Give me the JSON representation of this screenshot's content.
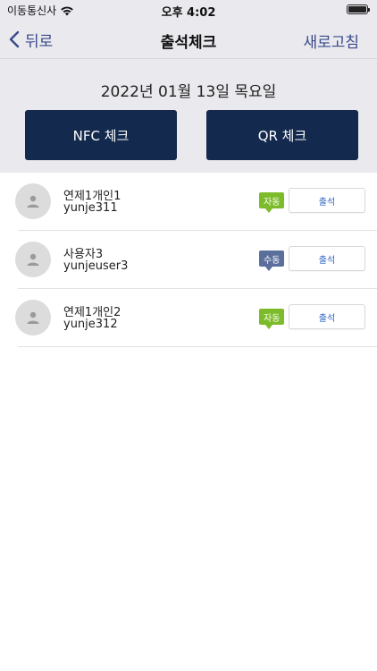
{
  "status_bar": {
    "carrier": "이동통신사",
    "time": "오후 4:02"
  },
  "nav": {
    "back_label": "뒤로",
    "title": "출석체크",
    "refresh_label": "새로고침"
  },
  "header": {
    "date": "2022년 01월 13일 목요일",
    "nfc_label": "NFC 체크",
    "qr_label": "QR 체크"
  },
  "users": [
    {
      "name": "연제1개인1",
      "id": "yunje311",
      "mode": "자동",
      "action": "출석"
    },
    {
      "name": "사용자3",
      "id": "yunjeuser3",
      "mode": "수동",
      "action": "출석"
    },
    {
      "name": "연제1개인2",
      "id": "yunje312",
      "mode": "자동",
      "action": "출석"
    }
  ],
  "colors": {
    "accent": "#3a4a8a",
    "button_dark": "#13294d",
    "auto_badge": "#7cbb2a",
    "manual_badge": "#5a6f9c",
    "attend_text": "#2f66c2"
  },
  "icons": {
    "back": "chevron-left-icon",
    "avatar": "person-icon",
    "wifi": "wifi-icon",
    "battery": "battery-icon"
  }
}
